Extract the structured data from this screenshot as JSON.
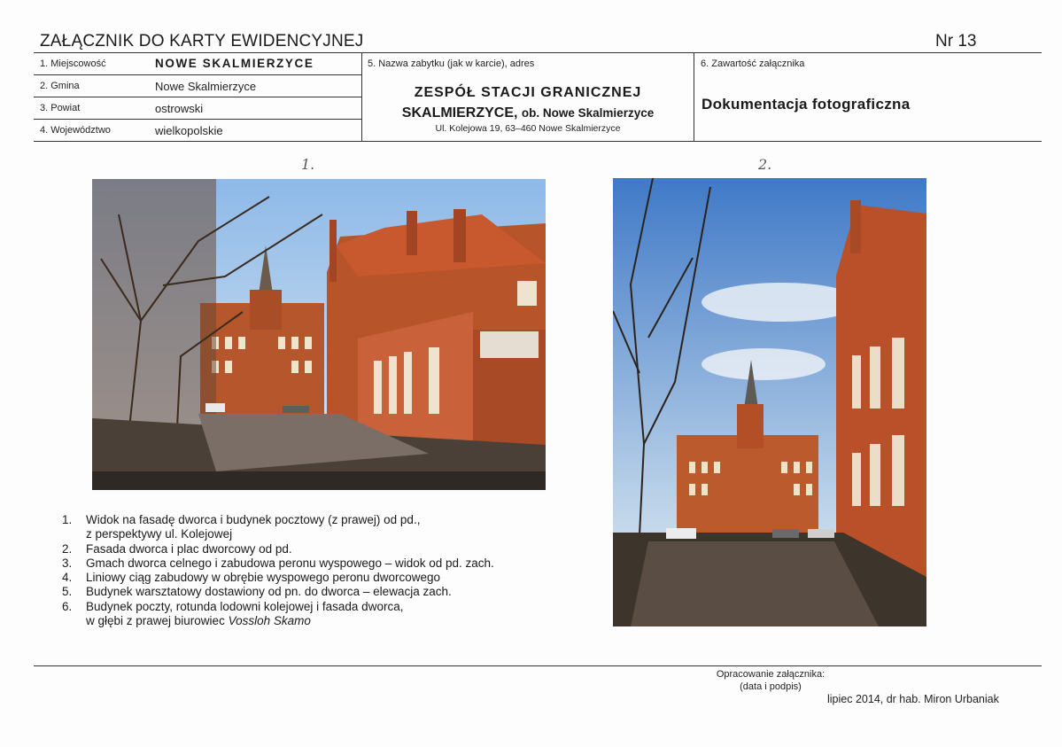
{
  "header": {
    "title": "ZAŁĄCZNIK DO KARTY EWIDENCYJNEJ",
    "number": "Nr 13"
  },
  "table": {
    "rows": [
      {
        "label": "1. Miejscowość",
        "value": "NOWE SKALMIERZYCE"
      },
      {
        "label": "2. Gmina",
        "value": "Nowe Skalmierzyce"
      },
      {
        "label": "3. Powiat",
        "value": "ostrowski"
      },
      {
        "label": "4. Województwo",
        "value": "wielkopolskie"
      }
    ],
    "monument": {
      "label": "5. Nazwa zabytku (jak w karcie), adres",
      "name_line1": "ZESPÓŁ STACJI GRANICZNEJ",
      "name_line2_main": "SKALMIERZYCE,",
      "name_line2_sub": "ob. Nowe Skalmierzyce",
      "address": "Ul. Kolejowa 19, 63–460 Nowe Skalmierzyce"
    },
    "contents": {
      "label": "6. Zawartość załącznika",
      "value": "Dokumentacja fotograficzna"
    }
  },
  "photos": [
    {
      "handwritten_number": "1."
    },
    {
      "handwritten_number": "2."
    }
  ],
  "captions": [
    {
      "num": "1.",
      "lines": [
        "Widok na fasadę dworca i budynek pocztowy (z prawej) od pd.,",
        "z perspektywy ul. Kolejowej"
      ]
    },
    {
      "num": "2.",
      "lines": [
        "Fasada dworca i plac dworcowy od pd."
      ]
    },
    {
      "num": "3.",
      "lines": [
        "Gmach dworca celnego i zabudowa peronu wyspowego – widok od pd. zach."
      ]
    },
    {
      "num": "4.",
      "lines": [
        "Liniowy ciąg zabudowy w obrębie wyspowego peronu dworcowego"
      ]
    },
    {
      "num": "5.",
      "lines": [
        "Budynek warsztatowy dostawiony od pn. do dworca – elewacja zach."
      ]
    },
    {
      "num": "6.",
      "lines": [
        "Budynek poczty, rotunda lodowni kolejowej i fasada dworca,"
      ],
      "last_line_prefix": "w głębi z prawej biurowiec ",
      "last_line_italic": "Vossloh Skamo"
    }
  ],
  "footer": {
    "label_line1": "Opracowanie załącznika:",
    "label_line2": "(data i podpis)",
    "signature": "lipiec 2014, dr hab. Miron Urbaniak"
  }
}
